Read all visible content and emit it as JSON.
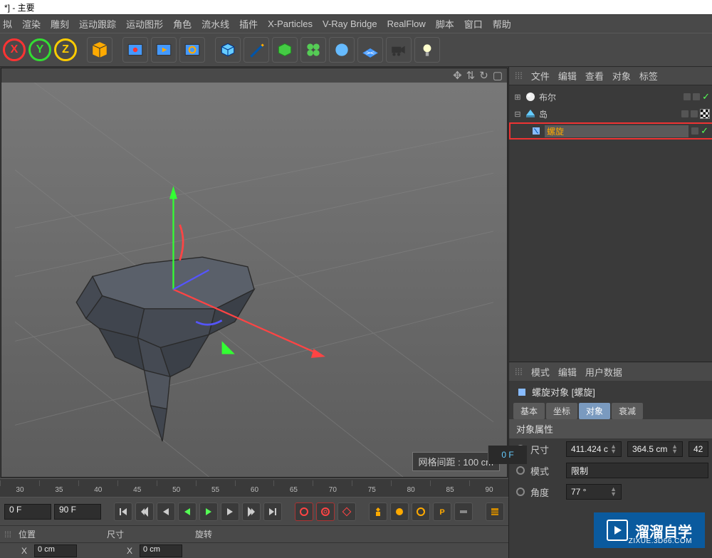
{
  "title": "*] - 主要",
  "menu": [
    "拟",
    "渲染",
    "雕刻",
    "运动跟踪",
    "运动图形",
    "角色",
    "流水线",
    "插件",
    "X-Particles",
    "V-Ray Bridge",
    "RealFlow",
    "脚本",
    "窗口",
    "帮助"
  ],
  "axis_btns": [
    "X",
    "Y",
    "Z"
  ],
  "viewport": {
    "grid_info": "网格间距 : 100 cm"
  },
  "timeline": {
    "ticks": [
      "30",
      "35",
      "40",
      "45",
      "50",
      "55",
      "60",
      "65",
      "70",
      "75",
      "80",
      "85",
      "90"
    ],
    "cur": "0 F"
  },
  "play": {
    "start": "0 F",
    "end": "90 F"
  },
  "coords": {
    "pos_lbl": "位置",
    "size_lbl": "尺寸",
    "rot_lbl": "旋转",
    "x_lbl": "X",
    "x_val": "0 cm",
    "sx_lbl": "X",
    "sx_val": "0 cm"
  },
  "obj_panel": {
    "menu": [
      "文件",
      "编辑",
      "查看",
      "对象",
      "标签"
    ],
    "items": [
      {
        "name": "布尔",
        "icon": "sphere",
        "sel": false,
        "chk": true
      },
      {
        "name": "岛",
        "icon": "island",
        "sel": false,
        "chk": false,
        "checker": true
      },
      {
        "name": "螺旋",
        "icon": "twist",
        "sel": true,
        "chk": true,
        "indent": true,
        "hl": true
      }
    ]
  },
  "attr": {
    "menu": [
      "模式",
      "编辑",
      "用户数据"
    ],
    "title": "螺旋对象 [螺旋]",
    "tabs": [
      "基本",
      "坐标",
      "对象",
      "衰减"
    ],
    "active_tab": 2,
    "section": "对象属性",
    "rows": [
      {
        "type": "nums",
        "label": "尺寸",
        "vals": [
          "411.424 c",
          "364.5 cm",
          "42"
        ]
      },
      {
        "type": "sel",
        "label": "模式",
        "val": "限制"
      },
      {
        "type": "num",
        "label": "角度",
        "val": "77 °"
      }
    ]
  },
  "wm": {
    "brand": "溜溜自学",
    "sub": "ZIXUE.3D66.COM"
  }
}
